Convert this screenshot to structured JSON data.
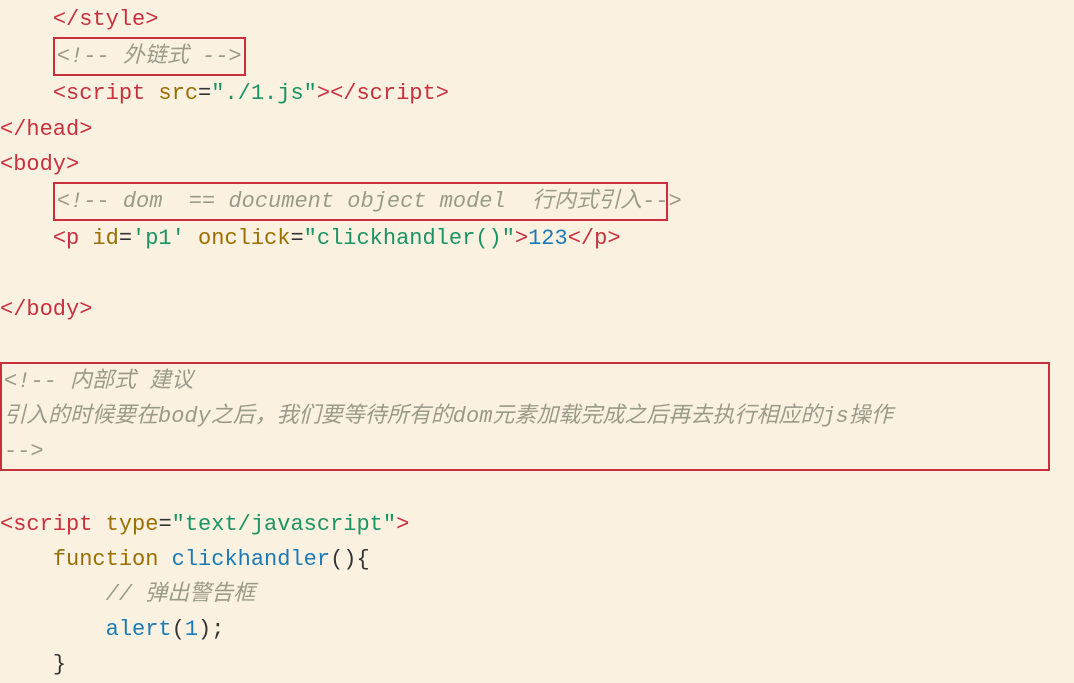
{
  "code": {
    "l1_close_style": "</style>",
    "l2_comment": "<!-- 外链式 -->",
    "l3_open_script": "<script",
    "l3_attr_src": " src",
    "l3_eq": "=",
    "l3_val_src": "\"./1.js\"",
    "l3_close_open": ">",
    "l3_close_script": "</script>",
    "l4_close_head": "</head>",
    "l5_open_body": "<body>",
    "l6_comment": "<!-- dom  == document object model  行内式引入-->",
    "l7_open_p": "<p",
    "l7_attr_id": " id",
    "l7_eq1": "=",
    "l7_val_id": "'p1'",
    "l7_attr_onclick": " onclick",
    "l7_eq2": "=",
    "l7_val_onclick": "\"clickhandler()\"",
    "l7_close_open": ">",
    "l7_text": "123",
    "l7_close_p": "</p>",
    "l8_close_body": "</body>",
    "l9_comment_1": "<!-- 内部式 建议",
    "l9_comment_2": "引入的时候要在body之后，我们要等待所有的dom元素加载完成之后再去执行相应的js操作",
    "l9_comment_3": "-->",
    "l10_open_script": "<script",
    "l10_attr_type": " type",
    "l10_eq": "=",
    "l10_val_type": "\"text/javascript\"",
    "l10_close_open": ">",
    "l11_func_kw": "function",
    "l11_func_name": " clickhandler",
    "l11_paren": "(){",
    "l12_comment": "// 弹出警告框",
    "l13_alert": "alert",
    "l13_paren_open": "(",
    "l13_num": "1",
    "l13_paren_close": ");",
    "l14_brace": "}"
  },
  "highlights": {
    "box1_line": 2,
    "box2_line": 6,
    "box3_lines": "9-11"
  }
}
